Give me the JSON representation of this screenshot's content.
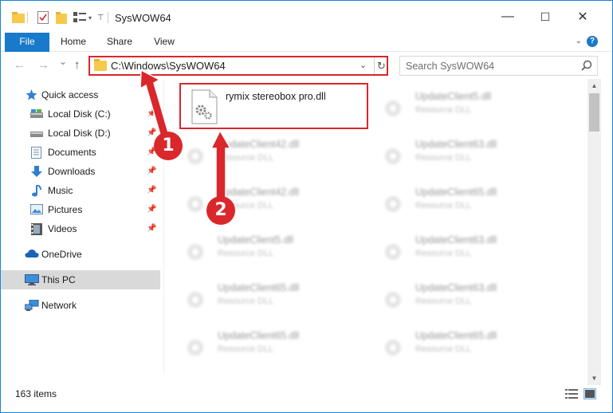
{
  "window": {
    "title": "SysWOW64",
    "controls": {
      "minimize": "—",
      "maximize": "☐",
      "close": "✕"
    }
  },
  "ribbon": {
    "tabs": [
      {
        "label": "File",
        "active": true
      },
      {
        "label": "Home"
      },
      {
        "label": "Share"
      },
      {
        "label": "View"
      }
    ],
    "help": "?"
  },
  "navigation": {
    "back": "←",
    "forward": "→",
    "recent": "⌄",
    "up": "↑",
    "address": "C:\\Windows\\SysWOW64",
    "search_placeholder": "Search SysWOW64"
  },
  "sidebar": {
    "items": [
      {
        "label": "Quick access",
        "icon": "star-icon"
      },
      {
        "label": "Local Disk (C:)",
        "icon": "drive-icon",
        "pinned": true
      },
      {
        "label": "Local Disk (D:)",
        "icon": "drive-icon",
        "pinned": true
      },
      {
        "label": "Documents",
        "icon": "documents-icon",
        "pinned": true
      },
      {
        "label": "Downloads",
        "icon": "downloads-icon",
        "pinned": true
      },
      {
        "label": "Music",
        "icon": "music-icon",
        "pinned": true
      },
      {
        "label": "Pictures",
        "icon": "pictures-icon",
        "pinned": true
      },
      {
        "label": "Videos",
        "icon": "videos-icon",
        "pinned": true
      },
      {
        "label": "OneDrive",
        "icon": "onedrive-icon"
      },
      {
        "label": "This PC",
        "icon": "computer-icon",
        "selected": true
      },
      {
        "label": "Network",
        "icon": "network-icon"
      }
    ]
  },
  "files": {
    "highlighted": {
      "name": "rymix stereobox pro.dll",
      "type": ""
    },
    "left_column": [
      {
        "name": "UpdateClient42.dll",
        "type": "Resource DLL"
      },
      {
        "name": "UpdateClient42.dll",
        "type": "Resource DLL"
      },
      {
        "name": "UpdateClient5.dll",
        "type": "Resource DLL"
      },
      {
        "name": "UpdateClient65.dll",
        "type": "Resource DLL"
      },
      {
        "name": "UpdateClient65.dll",
        "type": "Resource DLL"
      }
    ],
    "right_column": [
      {
        "name": "UpdateClient5.dll",
        "type": "Resource DLL"
      },
      {
        "name": "UpdateClient63.dll",
        "type": "Resource DLL"
      },
      {
        "name": "UpdateClient65.dll",
        "type": "Resource DLL"
      },
      {
        "name": "UpdateClient63.dll",
        "type": "Resource DLL"
      },
      {
        "name": "UpdateClient63.dll",
        "type": "Resource DLL"
      },
      {
        "name": "UpdateClient65.dll",
        "type": "Resource DLL"
      }
    ]
  },
  "status": {
    "count": "163 items"
  },
  "annotations": {
    "step1": "1",
    "step2": "2"
  },
  "colors": {
    "accent": "#1979ca",
    "highlight": "#d9272c",
    "folder": "#f6c94b"
  }
}
